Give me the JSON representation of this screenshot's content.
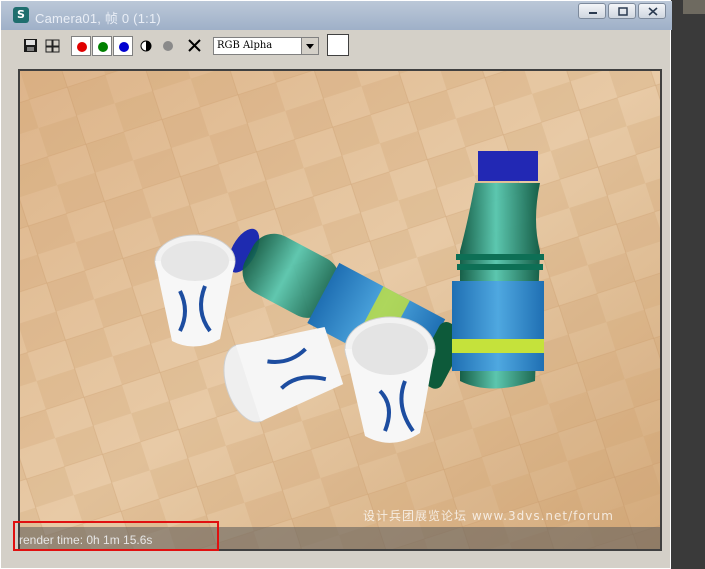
{
  "window": {
    "title": "Camera01, 帧 0 (1:1)",
    "controls": [
      "minimize-icon",
      "restore-icon",
      "close-icon"
    ]
  },
  "toolbar": {
    "save_icon": "floppy-disk-icon",
    "clone_icon": "clone-window-icon",
    "channels": [
      {
        "name": "red-channel",
        "color": "#e00000"
      },
      {
        "name": "green-channel",
        "color": "#008000"
      },
      {
        "name": "blue-channel",
        "color": "#0000d0"
      }
    ],
    "mono_icon": "monochrome-icon",
    "alpha_icon": "alpha-channel-icon",
    "clear_icon": "clear-x-icon",
    "channel_select": "RGB Alpha",
    "swatch_color": "#ffffff"
  },
  "render": {
    "status_text": "render time: 0h 1m 15.6s",
    "watermark": "设计兵团展览论坛 www.3dvs.net/forum"
  }
}
